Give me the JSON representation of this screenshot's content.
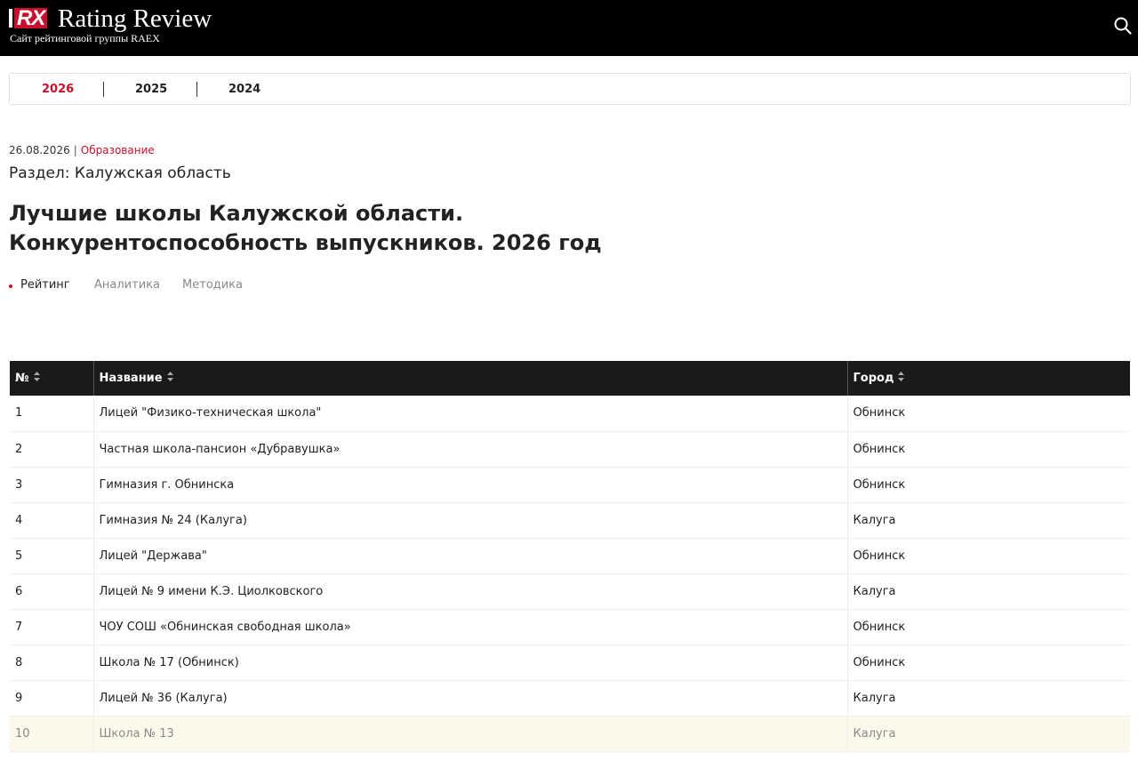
{
  "header": {
    "logo_text": "RX",
    "brand": "Rating Review",
    "tagline": "Сайт рейтинговой группы RAEX",
    "search_icon": "search-icon"
  },
  "years": [
    {
      "label": "2026",
      "active": true
    },
    {
      "label": "2025",
      "active": false
    },
    {
      "label": "2024",
      "active": false
    }
  ],
  "meta": {
    "date": "26.08.2026",
    "separator": "|",
    "category": "Образование"
  },
  "section": "Раздел: Калужская область",
  "title_line1": "Лучшие школы Калужской области.",
  "title_line2": "Конкурентоспособность выпускников. 2026 год",
  "subtabs": [
    {
      "label": "Рейтинг",
      "active": true
    },
    {
      "label": "Аналитика",
      "active": false
    },
    {
      "label": "Методика",
      "active": false
    }
  ],
  "table": {
    "headers": [
      "№",
      "Название",
      "Город"
    ],
    "rows": [
      [
        "1",
        "Лицей \"Физико-техническая школа\"",
        "Обнинск"
      ],
      [
        "2",
        "Частная школа-пансион «Дубравушка»",
        "Обнинск"
      ],
      [
        "3",
        "Гимназия г. Обнинска",
        "Обнинск"
      ],
      [
        "4",
        "Гимназия № 24 (Калуга)",
        "Калуга"
      ],
      [
        "5",
        "Лицей \"Держава\"",
        "Обнинск"
      ],
      [
        "6",
        "Лицей № 9 имени К.Э. Циолковского",
        "Калуга"
      ],
      [
        "7",
        "ЧОУ СОШ «Обнинская свободная школа»",
        "Обнинск"
      ],
      [
        "8",
        "Школа № 17 (Обнинск)",
        "Обнинск"
      ],
      [
        "9",
        "Лицей № 36 (Калуга)",
        "Калуга"
      ],
      [
        "10",
        "Школа № 13",
        "Калуга"
      ]
    ]
  },
  "colors": {
    "accent": "#c8102e",
    "header_bg": "#000000",
    "table_header_bg": "#1a1a1a",
    "highlight_row": "#fdf9ea"
  }
}
